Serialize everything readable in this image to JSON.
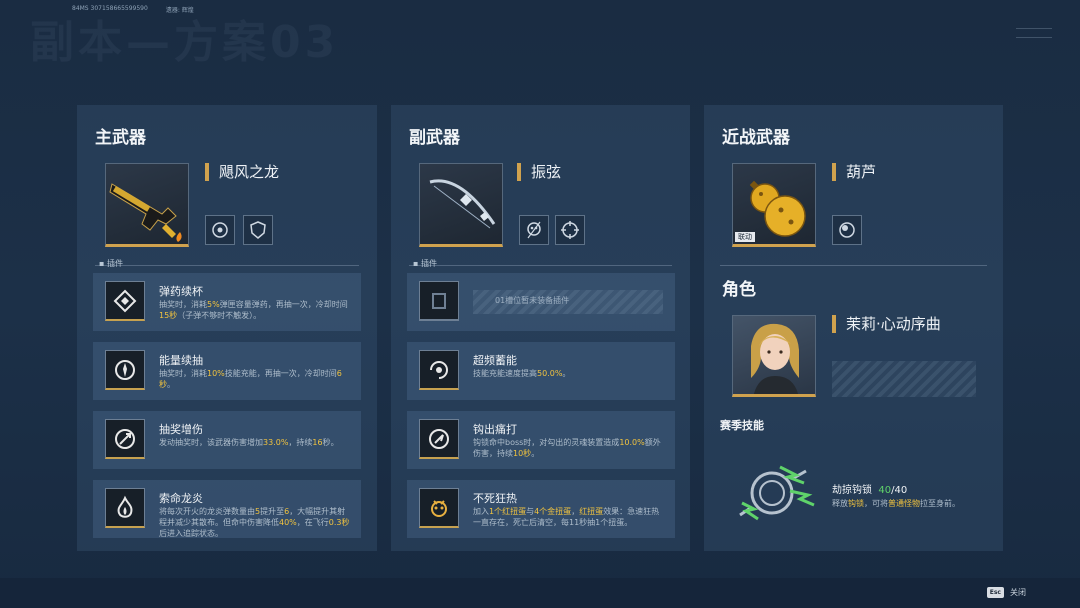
{
  "header": {
    "id_label": "84MS",
    "id_value": "307158665599590",
    "field_label": "遗器",
    "field_value": "辉煌",
    "bg_title": "副本—方案03"
  },
  "primary": {
    "title": "主武器",
    "weapon_name": "飓风之龙",
    "plugin_label": "插件",
    "mods": [
      {
        "name": "弹药续杯",
        "desc": [
          "抽奖时，消耗",
          "5%",
          "弹匣容量弹药，再抽一次，冷却时间",
          "15秒",
          "（子弹不够时不触发）。"
        ]
      },
      {
        "name": "能量续抽",
        "desc": [
          "抽奖时，消耗",
          "10%",
          "技能充能，再抽一次，冷却时间",
          "6秒",
          "。"
        ]
      },
      {
        "name": "抽奖增伤",
        "desc": [
          "发动抽奖时，该武器伤害增加",
          "33.0%",
          "，持续",
          "16",
          "秒。"
        ]
      },
      {
        "name": "索命龙炎",
        "desc": [
          "将每次开火的龙炎弹数量由",
          "5",
          "提升至",
          "6",
          "，大幅提升其射程并减少其散布。但命中伤害降低",
          "40%",
          "，在飞行",
          "0.3秒",
          "后进入追踪状态。"
        ]
      }
    ]
  },
  "secondary": {
    "title": "副武器",
    "weapon_name": "振弦",
    "plugin_label": "插件",
    "empty_slot": "01槽位暂未装备插件",
    "mods": [
      {
        "name": "超频蓄能",
        "desc": [
          "技能充能速度提高",
          "50.0%",
          "。"
        ]
      },
      {
        "name": "钩出痛打",
        "desc": [
          "钩锁命中boss时，对勾出的灵魂装置造成",
          "10.0%",
          "额外伤害，持续",
          "10秒",
          "。"
        ]
      },
      {
        "name": "不死狂热",
        "desc": [
          "加入",
          "1个红扭蛋",
          "与",
          "4个金扭蛋",
          "，",
          "红扭蛋",
          "效果：急速狂热一直存在，死亡后清空，每11秒抽1个扭蛋。"
        ]
      }
    ]
  },
  "melee": {
    "title": "近战武器",
    "weapon_name": "葫芦",
    "tag": "联动"
  },
  "character": {
    "title": "角色",
    "name": "茉莉·心动序曲",
    "season_title": "赛季技能",
    "skill_name": "劫掠钩锁",
    "skill_current": "40",
    "skill_max": "/40",
    "skill_desc": [
      "释放",
      "钩锁",
      "，可将",
      "普通怪物",
      "拉至身前。"
    ]
  },
  "footer": {
    "esc_key": "Esc",
    "close_label": "关闭"
  },
  "colors": {
    "accent_gold": "#d0a24e",
    "highlight": "#f1c33f",
    "skill_green": "#5fd36a",
    "panel_bg": "#3c5878"
  }
}
